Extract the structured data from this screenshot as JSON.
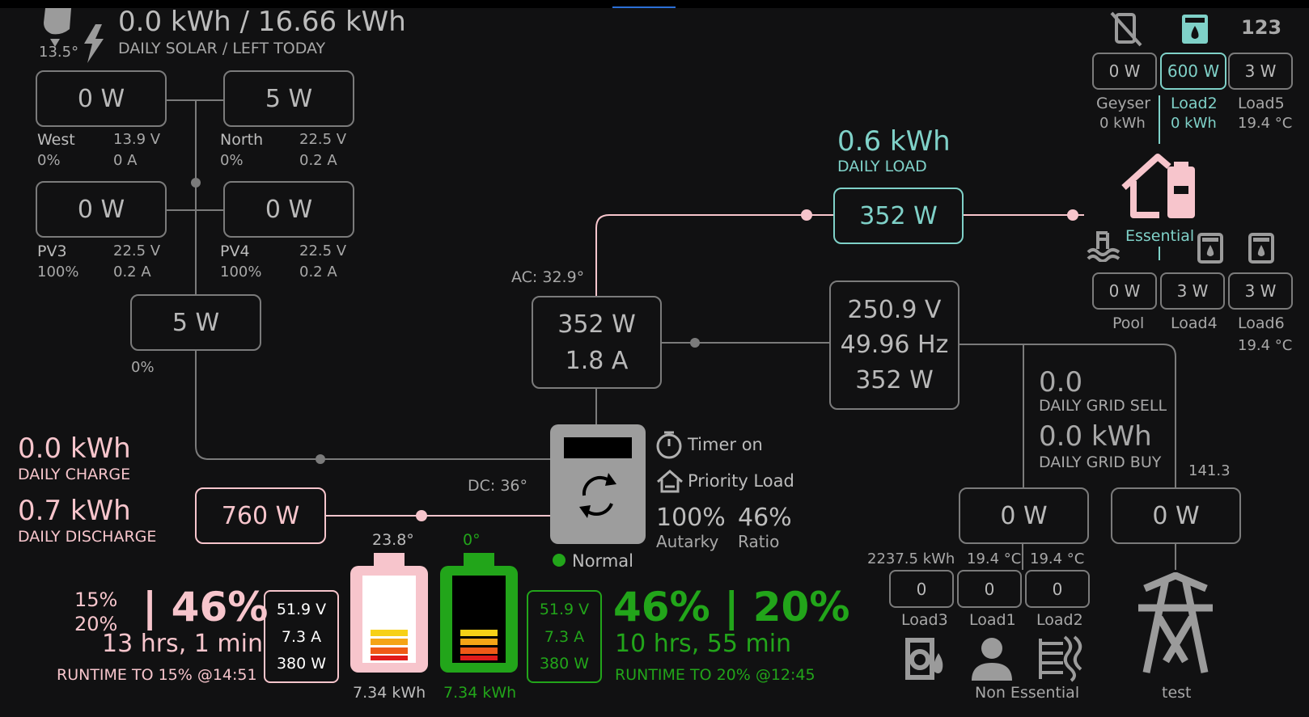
{
  "solar": {
    "daily": "0.0 kWh / 16.66 kWh",
    "daily_label": "DAILY SOLAR / LEFT TODAY",
    "temp": "13.5°",
    "pv1": {
      "power": "0 W",
      "name": "West",
      "pct": "0%",
      "volt": "13.9 V",
      "amp": "0 A"
    },
    "pv2": {
      "power": "5 W",
      "name": "North",
      "pct": "0%",
      "volt": "22.5 V",
      "amp": "0.2 A"
    },
    "pv3": {
      "power": "0 W",
      "name": "PV3",
      "pct": "100%",
      "volt": "22.5 V",
      "amp": "0.2 A"
    },
    "pv4": {
      "power": "0 W",
      "name": "PV4",
      "pct": "100%",
      "volt": "22.5 V",
      "amp": "0.2 A"
    },
    "total": {
      "power": "5 W",
      "pct": "0%"
    }
  },
  "inverter": {
    "ac_temp": "AC: 32.9°",
    "dc_temp": "DC: 36°",
    "power": "352 W",
    "current": "1.8 A",
    "status": "Normal",
    "timer": "Timer on",
    "priority": "Priority Load",
    "autarky_value": "100%",
    "autarky_label": "Autarky",
    "ratio_value": "46%",
    "ratio_label": "Ratio"
  },
  "grid": {
    "voltage": "250.9 V",
    "frequency": "49.96 Hz",
    "power": "352 W",
    "sell_value": "0.0",
    "sell_label": "DAILY GRID SELL",
    "buy_value": "0.0 kWh",
    "buy_label": "DAILY GRID BUY",
    "meter_value": "141.3",
    "box1": "0 W",
    "box2": "0 W",
    "tower_label": "test"
  },
  "load": {
    "daily_value": "0.6 kWh",
    "daily_label": "DAILY LOAD",
    "power": "352 W",
    "essential_label": "Essential",
    "aux": [
      {
        "power": "0 W",
        "name": "Geyser",
        "extra": "0 kWh"
      },
      {
        "power": "600 W",
        "name": "Load2",
        "extra": "0 kWh"
      },
      {
        "power": "3 W",
        "name": "Load5",
        "extra": "19.4 °C"
      }
    ],
    "essentials": [
      {
        "power": "0 W",
        "name": "Pool",
        "extra": ""
      },
      {
        "power": "3 W",
        "name": "Load4",
        "extra": ""
      },
      {
        "power": "3 W",
        "name": "Load6",
        "extra": "19.4 °C"
      }
    ],
    "top_right_label": "123"
  },
  "non_essential": {
    "label": "Non Essential",
    "energy": "2237.5 kWh",
    "temp1": "19.4 °C",
    "temp2": "19.4 °C",
    "loads": [
      {
        "value": "0",
        "name": "Load3"
      },
      {
        "value": "0",
        "name": "Load1"
      },
      {
        "value": "0",
        "name": "Load2"
      }
    ]
  },
  "battery": {
    "daily_charge_value": "0.0 kWh",
    "daily_charge_label": "DAILY CHARGE",
    "daily_discharge_value": "0.7 kWh",
    "daily_discharge_label": "DAILY DISCHARGE",
    "power": "760 W",
    "b1": {
      "temp": "23.8°",
      "energy": "7.34 kWh",
      "volt": "51.9 V",
      "amp": "7.3 A",
      "watt": "380 W",
      "soc": "| 46%",
      "level_a": "15%",
      "level_b": "20%",
      "runtime": "13 hrs, 1 min",
      "runtime_label": "RUNTIME TO 15% @14:51"
    },
    "b2": {
      "temp": "0°",
      "energy": "7.34 kWh",
      "volt": "51.9 V",
      "amp": "7.3 A",
      "watt": "380 W",
      "soc": "46% | 20%",
      "runtime": "10 hrs, 55 min",
      "runtime_label": "RUNTIME TO 20% @12:45"
    }
  },
  "colors": {
    "background": "#111112",
    "line": "#7b7b7b",
    "pink": "#f7c5cc",
    "teal": "#7fd1c8",
    "green": "#22a51a",
    "inverter": "#9d9d9d"
  }
}
